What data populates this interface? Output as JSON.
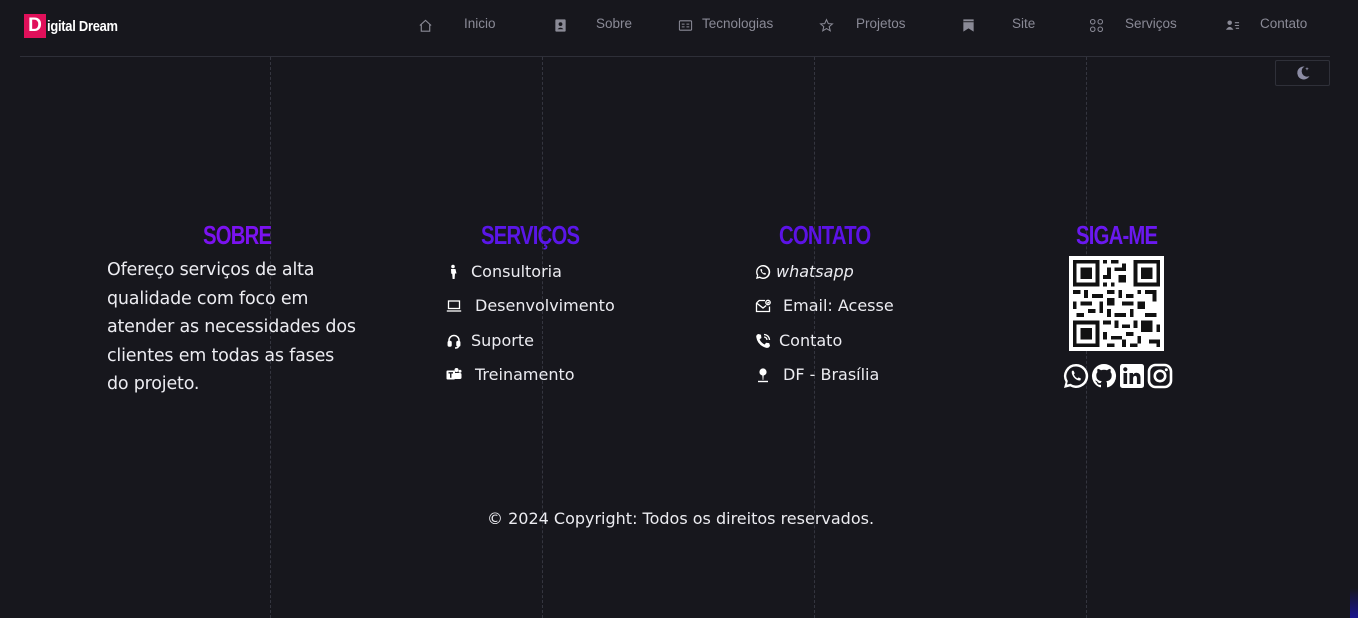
{
  "brand": {
    "letter": "D",
    "name": "igital Dream",
    "accent": "#e0105a"
  },
  "nav": [
    {
      "id": "inicio",
      "label": "Inicio",
      "icon": "home-icon"
    },
    {
      "id": "sobre",
      "label": "Sobre",
      "icon": "contact-book-icon"
    },
    {
      "id": "tecnologias",
      "label": "Tecnologias",
      "icon": "id-card-icon"
    },
    {
      "id": "projetos",
      "label": "Projetos",
      "icon": "star-icon"
    },
    {
      "id": "site",
      "label": "Site",
      "icon": "bookmark-icon"
    },
    {
      "id": "servicos",
      "label": "Serviços",
      "icon": "grid-icon"
    },
    {
      "id": "contato",
      "label": "Contato",
      "icon": "user-list-icon"
    }
  ],
  "theme_toggle": {
    "icon": "moon-stars-icon"
  },
  "footer": {
    "sobre": {
      "title": "SOBRE",
      "text": "Ofereço serviços de alta qualidade com foco em atender as necessidades dos clientes em todas as fases do projeto."
    },
    "servicos": {
      "title": "SERVIÇOS",
      "items": [
        {
          "label": "Consultoria",
          "icon": "person-icon"
        },
        {
          "label": "Desenvolvimento",
          "icon": "laptop-icon"
        },
        {
          "label": "Suporte",
          "icon": "headset-icon"
        },
        {
          "label": "Treinamento",
          "icon": "teams-icon"
        }
      ]
    },
    "contato": {
      "title": "CONTATO",
      "items": [
        {
          "label": "whatsapp",
          "icon": "whatsapp-icon"
        },
        {
          "label": "Email: Acesse",
          "icon": "envelope-icon"
        },
        {
          "label": "Contato",
          "icon": "phone-icon"
        },
        {
          "label": "DF - Brasília",
          "icon": "map-pin-icon"
        }
      ]
    },
    "siga": {
      "title": "SIGA-ME",
      "qr": "qr-code",
      "social": [
        "whatsapp-icon",
        "github-icon",
        "linkedin-icon",
        "instagram-icon"
      ]
    },
    "copyright": "© 2024 Copyright: Todos os direitos reservados."
  },
  "colors": {
    "background": "#17171d",
    "title_sobre": "#7b12f0",
    "title_servicos": "#5a16e8",
    "title_contato": "#5c12e6",
    "title_siga": "#6a18f0",
    "nav_text": "#8a8a96"
  }
}
